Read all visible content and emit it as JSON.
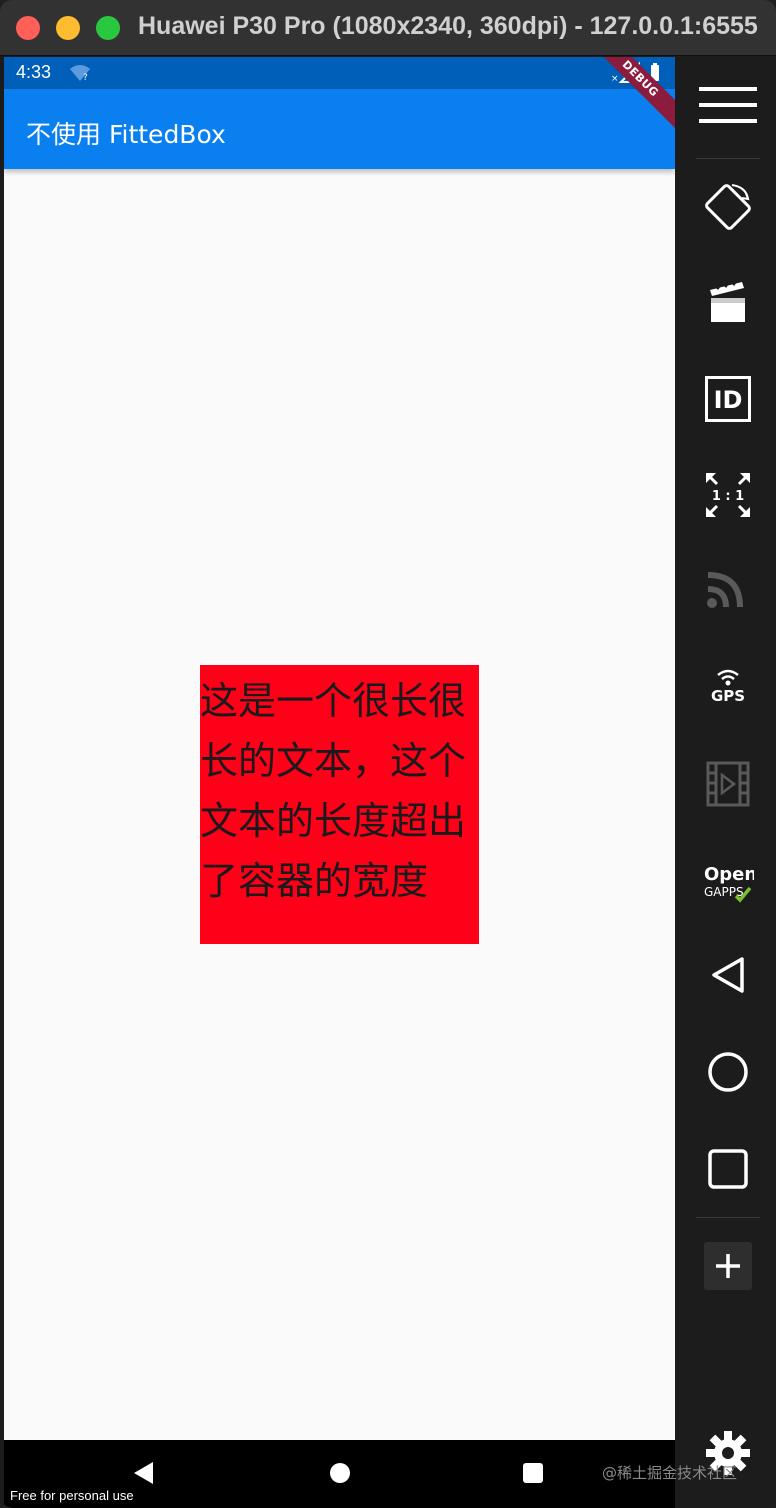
{
  "window": {
    "title": "Huawei P30 Pro (1080x2340, 360dpi) - 127.0.0.1:6555"
  },
  "statusbar": {
    "time": "4:33"
  },
  "appbar": {
    "title": "不使用 FittedBox",
    "debug_banner": "DEBUG"
  },
  "content": {
    "box_text": "这是一个很长很长的文本，这个文本的长度超出了容器的宽度"
  },
  "navbar": {
    "free_text": "Free for personal use"
  },
  "sidebar": {
    "items": [
      {
        "icon": "menu-icon"
      },
      {
        "icon": "rotate-icon"
      },
      {
        "icon": "screen-record-icon"
      },
      {
        "icon": "device-id-icon"
      },
      {
        "icon": "pixel-perfect-icon",
        "label": "1 : 1"
      },
      {
        "icon": "cast-icon"
      },
      {
        "icon": "gps-icon",
        "label": "GPS"
      },
      {
        "icon": "media-icon"
      },
      {
        "icon": "opengapps-icon",
        "label_top": "Open",
        "label_bottom": "GAPPS"
      },
      {
        "icon": "back-icon"
      },
      {
        "icon": "home-icon"
      },
      {
        "icon": "recents-icon"
      },
      {
        "icon": "add-icon"
      },
      {
        "icon": "settings-icon"
      }
    ]
  },
  "watermark": "@稀土掘金技术社区",
  "colors": {
    "appbar": "#0a7ff0",
    "statusbar": "#005fb8",
    "box": "#ff0019",
    "background": "#fafafa"
  }
}
